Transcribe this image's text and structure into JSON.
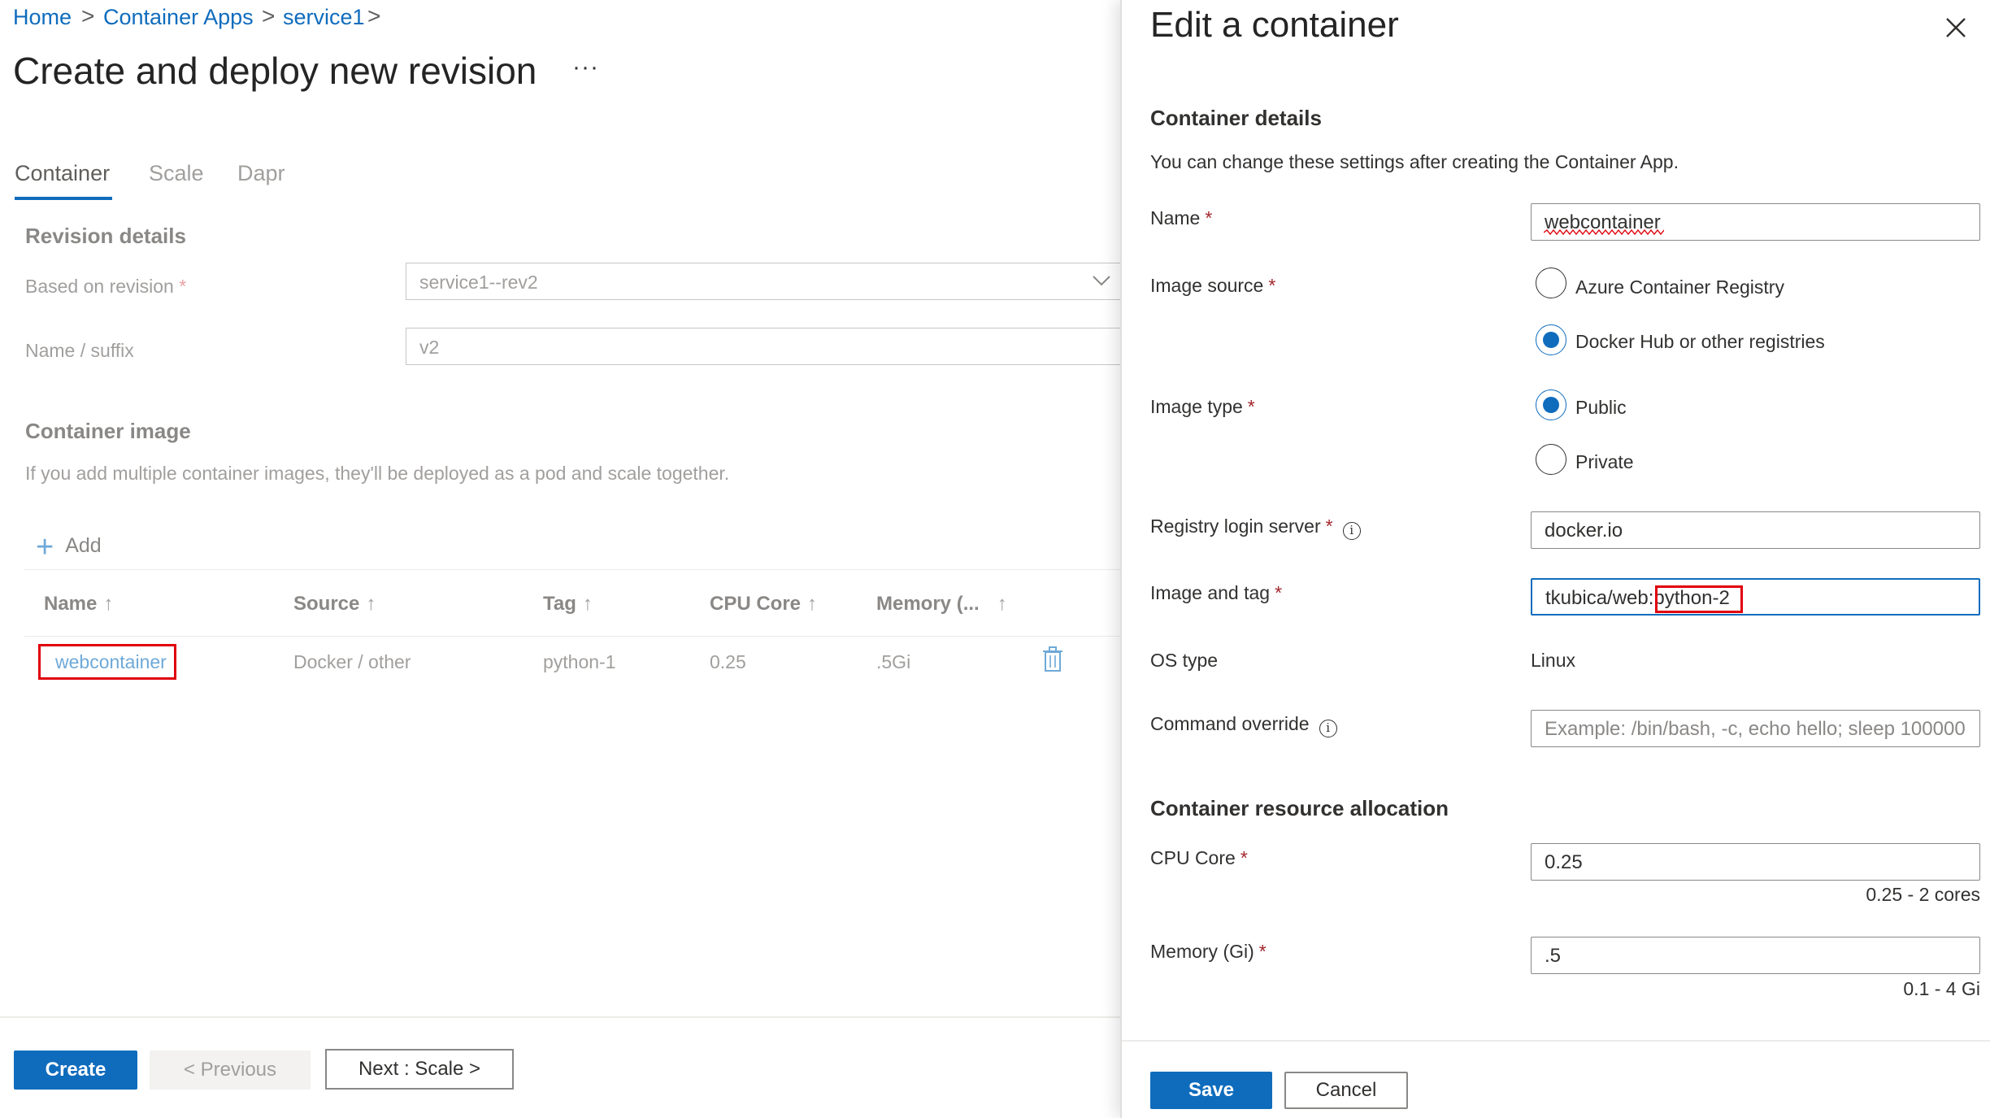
{
  "breadcrumb": {
    "items": [
      "Home",
      "Container Apps",
      "service1"
    ],
    "separator": ">"
  },
  "page": {
    "title": "Create and deploy new revision",
    "more": "···"
  },
  "tabs": [
    "Container",
    "Scale",
    "Dapr"
  ],
  "revision_details": {
    "heading": "Revision details",
    "based_on_label": "Based on revision",
    "based_on_value": "service1--rev2",
    "name_suffix_label": "Name / suffix",
    "name_suffix_value": "v2"
  },
  "container_image": {
    "heading": "Container image",
    "description": "If you add multiple container images, they'll be deployed as a pod and scale together.",
    "add_label": "Add",
    "columns": [
      "Name",
      "Source",
      "Tag",
      "CPU Core",
      "Memory (..."
    ],
    "sort_arrow": "↑",
    "rows": [
      {
        "name": "webcontainer",
        "source": "Docker / other",
        "tag": "python-1",
        "cpu": "0.25",
        "memory": ".5Gi"
      }
    ]
  },
  "footer": {
    "create": "Create",
    "previous": "< Previous",
    "next": "Next : Scale >"
  },
  "panel": {
    "title": "Edit a container",
    "details_heading": "Container details",
    "details_note": "You can change these settings after creating the Container App.",
    "name_label": "Name",
    "name_value": "webcontainer",
    "image_source_label": "Image source",
    "image_source_options": [
      "Azure Container Registry",
      "Docker Hub or other registries"
    ],
    "image_source_selected": 1,
    "image_type_label": "Image type",
    "image_type_options": [
      "Public",
      "Private"
    ],
    "image_type_selected": 0,
    "registry_label": "Registry login server",
    "registry_value": "docker.io",
    "image_tag_label": "Image and tag",
    "image_tag_value": "tkubica/web:python-2",
    "os_type_label": "OS type",
    "os_type_value": "Linux",
    "command_label": "Command override",
    "command_placeholder": "Example: /bin/bash, -c, echo hello; sleep 100000",
    "resource_heading": "Container resource allocation",
    "cpu_label": "CPU Core",
    "cpu_value": "0.25",
    "cpu_hint": "0.25 - 2 cores",
    "memory_label": "Memory (Gi)",
    "memory_value": ".5",
    "memory_hint": "0.1 - 4 Gi",
    "save": "Save",
    "cancel": "Cancel",
    "required_marker": "*",
    "info_glyph": "i"
  },
  "colors": {
    "accent": "#0f6cbd",
    "highlight_box": "#e0000b",
    "required": "#a4262c"
  }
}
